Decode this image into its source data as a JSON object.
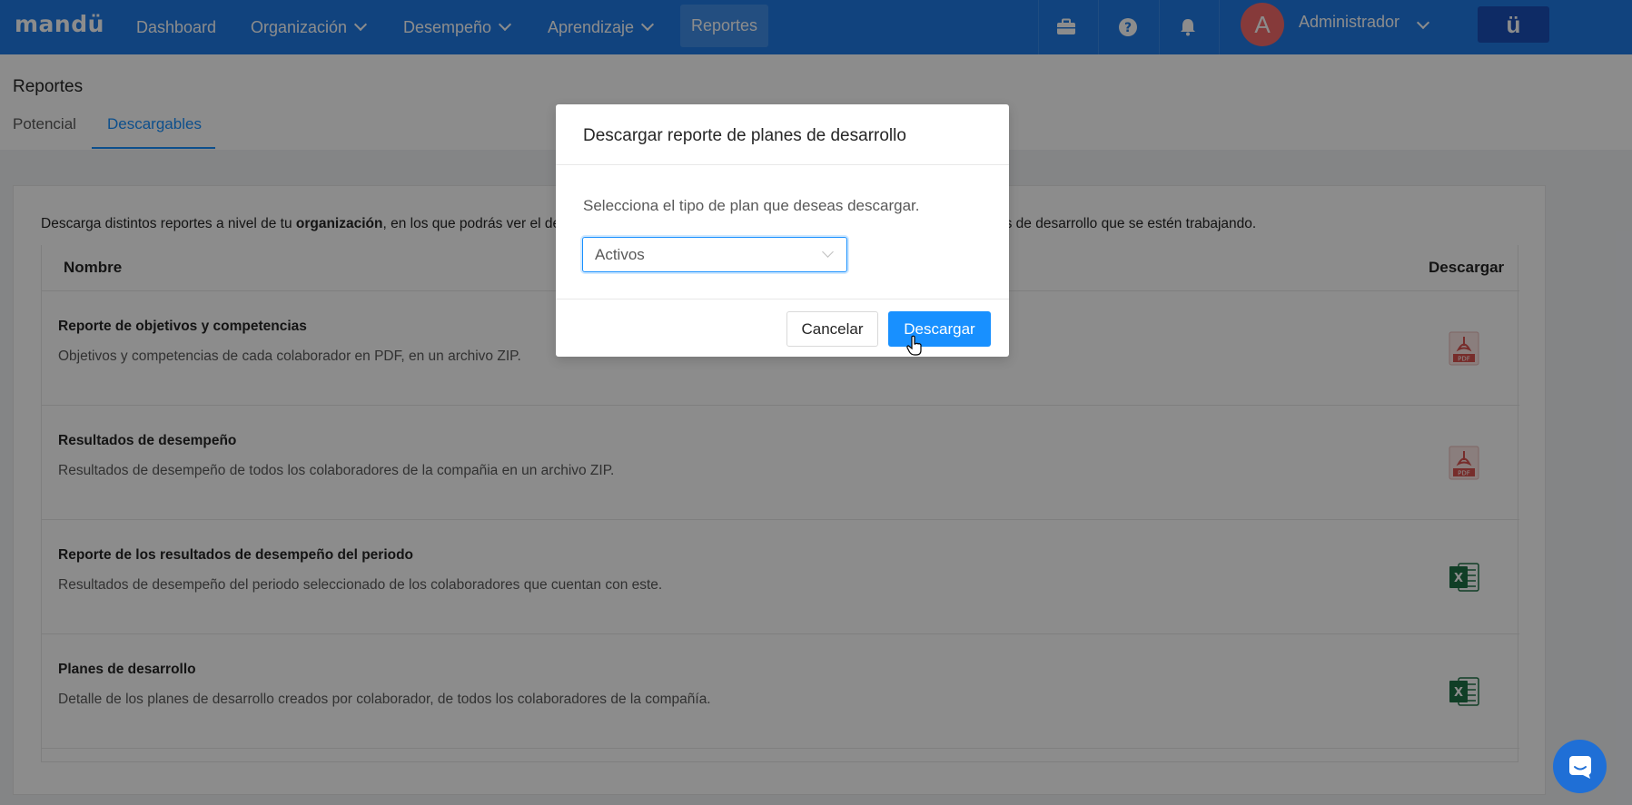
{
  "nav": {
    "logo": "mandü",
    "items": [
      {
        "label": "Dashboard"
      },
      {
        "label": "Organización"
      },
      {
        "label": "Desempeño"
      },
      {
        "label": "Aprendizaje"
      },
      {
        "label": "Reportes"
      }
    ],
    "icons": [
      "briefcase-icon",
      "help-icon",
      "bell-icon"
    ],
    "user": {
      "avatar_initial": "A",
      "name": "Administrador"
    },
    "brand_button": "ü"
  },
  "page": {
    "title": "Reportes",
    "tabs": [
      {
        "label": "Potencial"
      },
      {
        "label": "Descargables"
      }
    ]
  },
  "card": {
    "intro_pre": "Descarga distintos reportes a nivel de tu ",
    "intro_bold": "organización",
    "intro_post": ", en los que podrás ver el de",
    "intro_right": "es de desarrollo que se estén trabajando.",
    "columns": {
      "name": "Nombre",
      "download": "Descargar"
    },
    "rows": [
      {
        "title": "Reporte de objetivos y competencias",
        "desc": "Objetivos y competencias de cada colaborador en PDF, en un archivo ZIP.",
        "icon": "pdf-file-icon",
        "icon_label": "PDF"
      },
      {
        "title": "Resultados de desempeño",
        "desc": "Resultados de desempeño de todos los colaboradores de la compañia en un archivo ZIP.",
        "icon": "pdf-file-icon",
        "icon_label": "PDF"
      },
      {
        "title": "Reporte de los resultados de desempeño del periodo",
        "desc": "Resultados de desempeño del periodo seleccionado de los colaboradores que cuentan con este.",
        "icon": "excel-file-icon",
        "icon_label": "X"
      },
      {
        "title": "Planes de desarrollo",
        "desc": "Detalle de los planes de desarrollo creados por colaborador, de todos los colaboradores de la compañía.",
        "icon": "excel-file-icon",
        "icon_label": "X"
      }
    ]
  },
  "modal": {
    "title": "Descargar reporte de planes de desarrollo",
    "text": "Selecciona el tipo de plan que deseas descargar.",
    "select_value": "Activos",
    "cancel_label": "Cancelar",
    "download_label": "Descargar"
  },
  "colors": {
    "nav_bg": "#1f7be6",
    "accent": "#1890ff",
    "pdf_red": "#d9534f",
    "excel_green": "#1e7145"
  }
}
